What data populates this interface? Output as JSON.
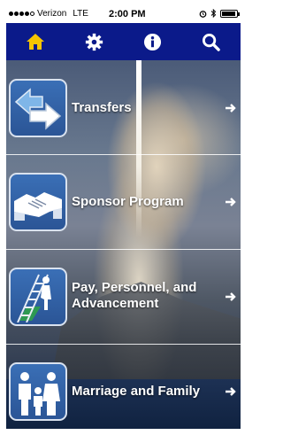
{
  "status_bar": {
    "carrier": "Verizon",
    "network": "LTE",
    "time": "2:00 PM"
  },
  "toolbar": {
    "items": [
      {
        "icon": "home-icon"
      },
      {
        "icon": "gear-icon"
      },
      {
        "icon": "info-icon"
      },
      {
        "icon": "search-icon"
      }
    ]
  },
  "menu": {
    "items": [
      {
        "label": "Transfers",
        "icon": "transfer-arrows-icon"
      },
      {
        "label": "Sponsor Program",
        "icon": "handshake-icon"
      },
      {
        "label": "Pay, Personnel, and Advancement",
        "icon": "ladder-climber-icon"
      },
      {
        "label": "Marriage and Family",
        "icon": "family-icon"
      }
    ]
  },
  "colors": {
    "toolbar_bg": "#0b1a8a",
    "home_icon": "#f5c400",
    "tile_bg": "#2b5596"
  }
}
